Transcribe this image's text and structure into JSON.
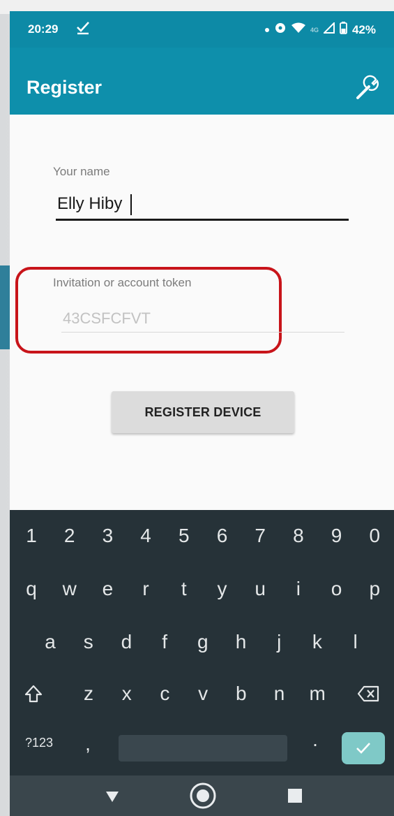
{
  "status_bar": {
    "time": "20:29",
    "battery": "42%"
  },
  "app_bar": {
    "title": "Register"
  },
  "form": {
    "name_label": "Your name",
    "name_value": "Elly Hiby",
    "token_label": "Invitation or account token",
    "token_placeholder": "43CSFCFVT",
    "register_button": "REGISTER DEVICE"
  },
  "keyboard": {
    "row1": [
      "1",
      "2",
      "3",
      "4",
      "5",
      "6",
      "7",
      "8",
      "9",
      "0"
    ],
    "row2": [
      "q",
      "w",
      "e",
      "r",
      "t",
      "y",
      "u",
      "i",
      "o",
      "p"
    ],
    "row3": [
      "a",
      "s",
      "d",
      "f",
      "g",
      "h",
      "j",
      "k",
      "l"
    ],
    "row4": [
      "z",
      "x",
      "c",
      "v",
      "b",
      "n",
      "m"
    ],
    "symbols_key": "?123",
    "comma_key": ",",
    "period_key": "."
  },
  "colors": {
    "primary": "#0e8fab",
    "highlight": "#c8141a",
    "keyboard_bg": "#263238",
    "enter_key": "#7fc9c7"
  }
}
